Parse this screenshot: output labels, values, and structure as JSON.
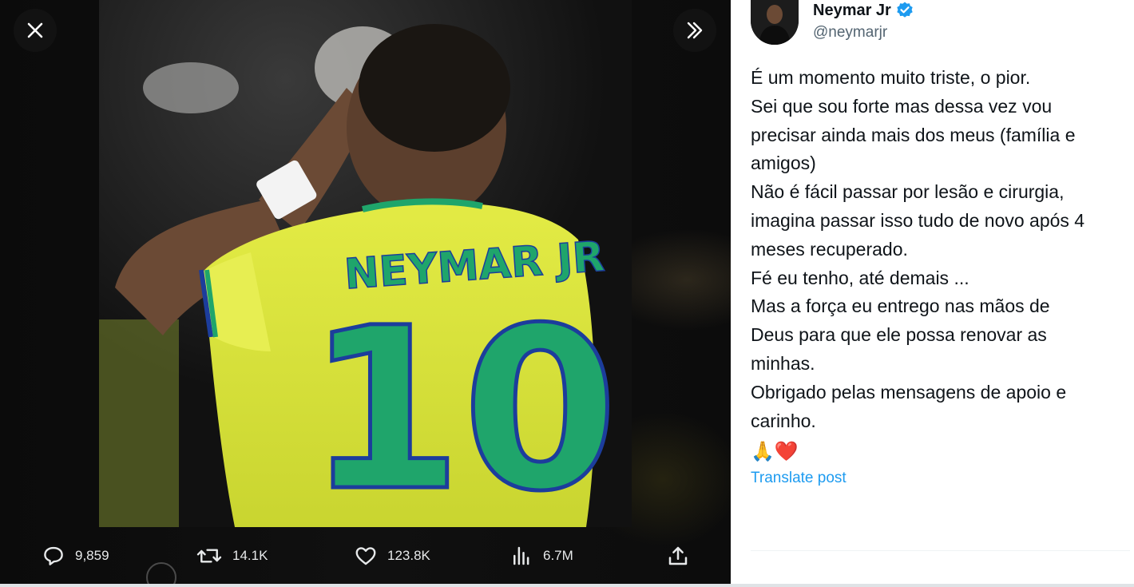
{
  "media": {
    "jersey_name": "NEYMAR JR",
    "jersey_number": "10",
    "controls": {
      "close_icon": "close-icon",
      "expand_icon": "chevrons-right-icon"
    }
  },
  "actions": {
    "replies": "9,859",
    "reposts": "14.1K",
    "likes": "123.8K",
    "views": "6.7M"
  },
  "post": {
    "author_name": "Neymar Jr",
    "author_handle": "@neymarjr",
    "verified": true,
    "lines": [
      "É um momento muito triste, o pior.",
      "Sei que sou forte mas dessa vez vou",
      "precisar ainda mais dos meus (família e",
      "amigos)",
      "Não é fácil passar por lesão e cirurgia,",
      "imagina passar isso tudo de novo após 4",
      "meses recuperado.",
      "Fé eu tenho, até demais ...",
      "Mas a força eu entrego nas mãos de",
      "Deus para que ele possa renovar as",
      "minhas.",
      "Obrigado pelas mensagens de apoio e",
      "carinho."
    ],
    "emoji": "🙏❤️",
    "translate_label": "Translate post"
  },
  "colors": {
    "accent": "#1d9bf0",
    "jersey_yellow": "#d9e437",
    "jersey_green": "#1fa56b",
    "jersey_blue": "#1c3d9c"
  }
}
